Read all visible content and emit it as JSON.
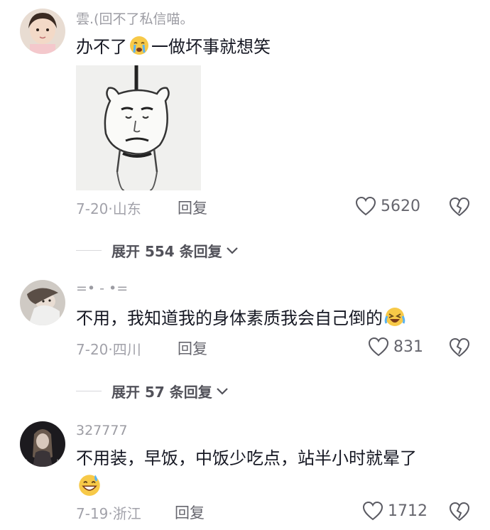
{
  "comments": [
    {
      "username": "雲.(回不了私信喵。",
      "text_before": "办不了",
      "text_after": "一做坏事就想笑",
      "emoji_inline": "crying-face",
      "date": "7-20",
      "location": "山东",
      "reply_label": "回复",
      "like_count": "5620",
      "expand_label": "展开 554 条回复"
    },
    {
      "username": "=• - •=",
      "text": "不用，我知道我的身体素质我会自己倒的",
      "emoji_inline": "rolling-laughing-face",
      "date": "7-20",
      "location": "四川",
      "reply_label": "回复",
      "like_count": "831",
      "expand_label": "展开 57 条回复"
    },
    {
      "username": "327777",
      "text": "不用装，早饭，中饭少吃点，站半小时就晕了",
      "emoji_inline": "grinning-sweat-face",
      "date": "7-19",
      "location": "浙江",
      "reply_label": "回复",
      "like_count": "1712"
    }
  ],
  "date_separator": "·"
}
